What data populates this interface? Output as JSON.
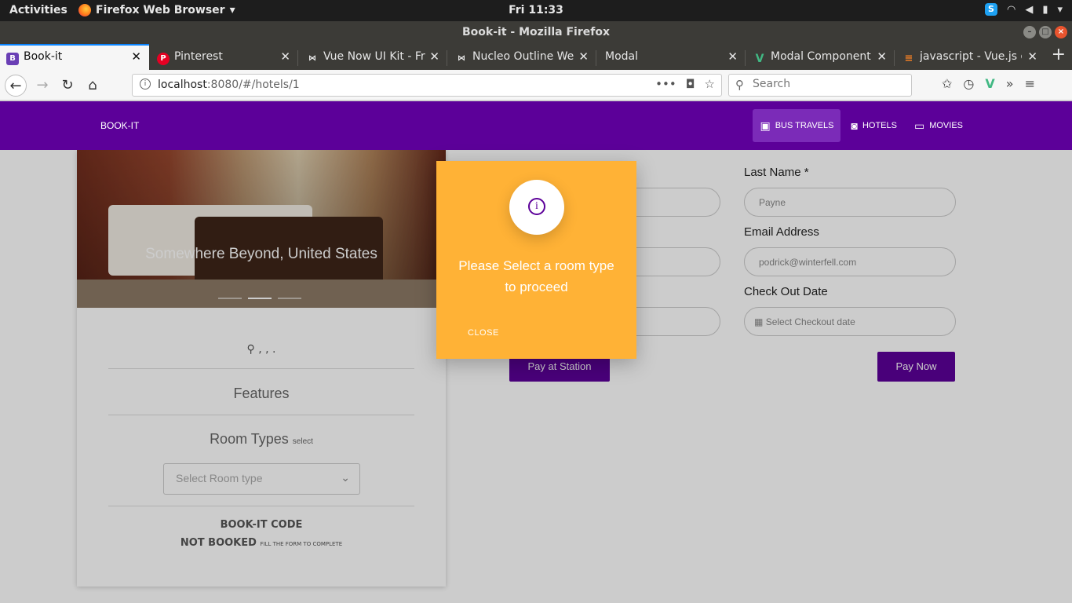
{
  "os": {
    "activities": "Activities",
    "app_menu": "Firefox Web Browser",
    "clock": "Fri 11:33"
  },
  "window": {
    "title": "Book-it - Mozilla Firefox"
  },
  "tabs": [
    {
      "label": "Book-it",
      "icon": "booking-favicon",
      "active": true
    },
    {
      "label": "Pinterest",
      "icon": "pinterest-favicon",
      "active": false
    },
    {
      "label": "Vue Now UI Kit - Fre",
      "icon": "bowtie-favicon",
      "active": false
    },
    {
      "label": "Nucleo Outline Web",
      "icon": "bowtie-favicon",
      "active": false
    },
    {
      "label": "Modal",
      "icon": "",
      "active": false
    },
    {
      "label": "Modal Component",
      "icon": "vue-favicon",
      "active": false
    },
    {
      "label": "javascript - Vue.js o",
      "icon": "stackoverflow-favicon",
      "active": false
    }
  ],
  "address_bar": {
    "host": "localhost",
    "rest": ":8080/#/hotels/1"
  },
  "search": {
    "placeholder": "Search"
  },
  "site": {
    "brand": "BOOK-IT",
    "nav": [
      {
        "label": "BUS TRAVELS",
        "icon": "bus-icon",
        "active": true
      },
      {
        "label": "HOTELS",
        "icon": "camera-icon",
        "active": false
      },
      {
        "label": "MOVIES",
        "icon": "monitor-icon",
        "active": false
      }
    ],
    "accent": "#5c0099"
  },
  "hotel_card": {
    "caption": "Somewhere Beyond, United States",
    "location": ", , .",
    "features_heading": "Features",
    "room_types_heading": "Room Types",
    "room_types_hint": "select",
    "room_select_placeholder": "Select Room type",
    "code_label": "BOOK-IT CODE",
    "status": "NOT BOOKED",
    "status_hint": "FILL THE FORM TO COMPLETE"
  },
  "form": {
    "last_name_label": "Last Name *",
    "last_name_value": "Payne",
    "email_label": "Email Address",
    "email_value": "podrick@winterfell.com",
    "checkout_label": "Check Out Date",
    "checkout_placeholder": "Select Checkout date",
    "pay_station": "Pay at Station",
    "pay_now": "Pay Now"
  },
  "modal": {
    "message": "Please Select a room type to proceed",
    "close": "CLOSE",
    "color": "#ffb236"
  }
}
